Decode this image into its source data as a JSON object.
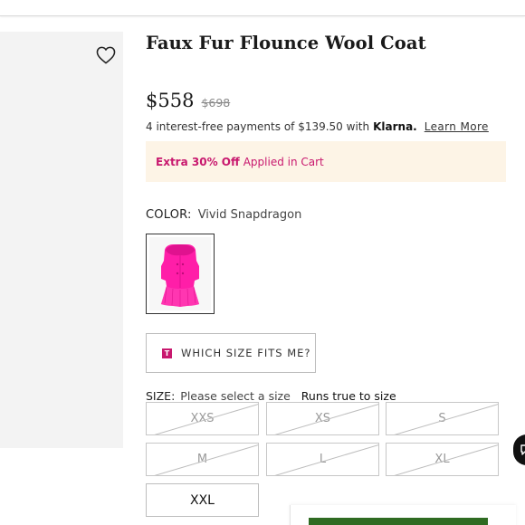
{
  "product": {
    "title": "Faux Fur Flounce Wool Coat",
    "price": "$558",
    "original_price": "$698"
  },
  "klarna": {
    "text": "4 interest-free payments of $139.50 with",
    "brand": "Klarna.",
    "link": "Learn More"
  },
  "promo": {
    "highlight": "Extra 30% Off",
    "rest": "Applied in Cart",
    "color": "#c8186e",
    "background": "#fdf4e6"
  },
  "color": {
    "label": "COLOR:",
    "value": "Vivid Snapdragon",
    "swatch_color": "#ff1ea8"
  },
  "fit_finder": {
    "label": "WHICH SIZE FITS ME?",
    "icon_letter": "T"
  },
  "size": {
    "label": "SIZE:",
    "value": "Please select a size",
    "hint": "Runs true to size",
    "options": [
      {
        "label": "XXS",
        "available": false
      },
      {
        "label": "XS",
        "available": false
      },
      {
        "label": "S",
        "available": false
      },
      {
        "label": "M",
        "available": false
      },
      {
        "label": "L",
        "available": false
      },
      {
        "label": "XL",
        "available": false
      },
      {
        "label": "XXL",
        "available": true
      }
    ]
  },
  "icons": {
    "wishlist": "heart-icon",
    "chat": "chat-icon"
  },
  "colors": {
    "add_to_bag": "#2f6b22",
    "chat": "#111111"
  }
}
